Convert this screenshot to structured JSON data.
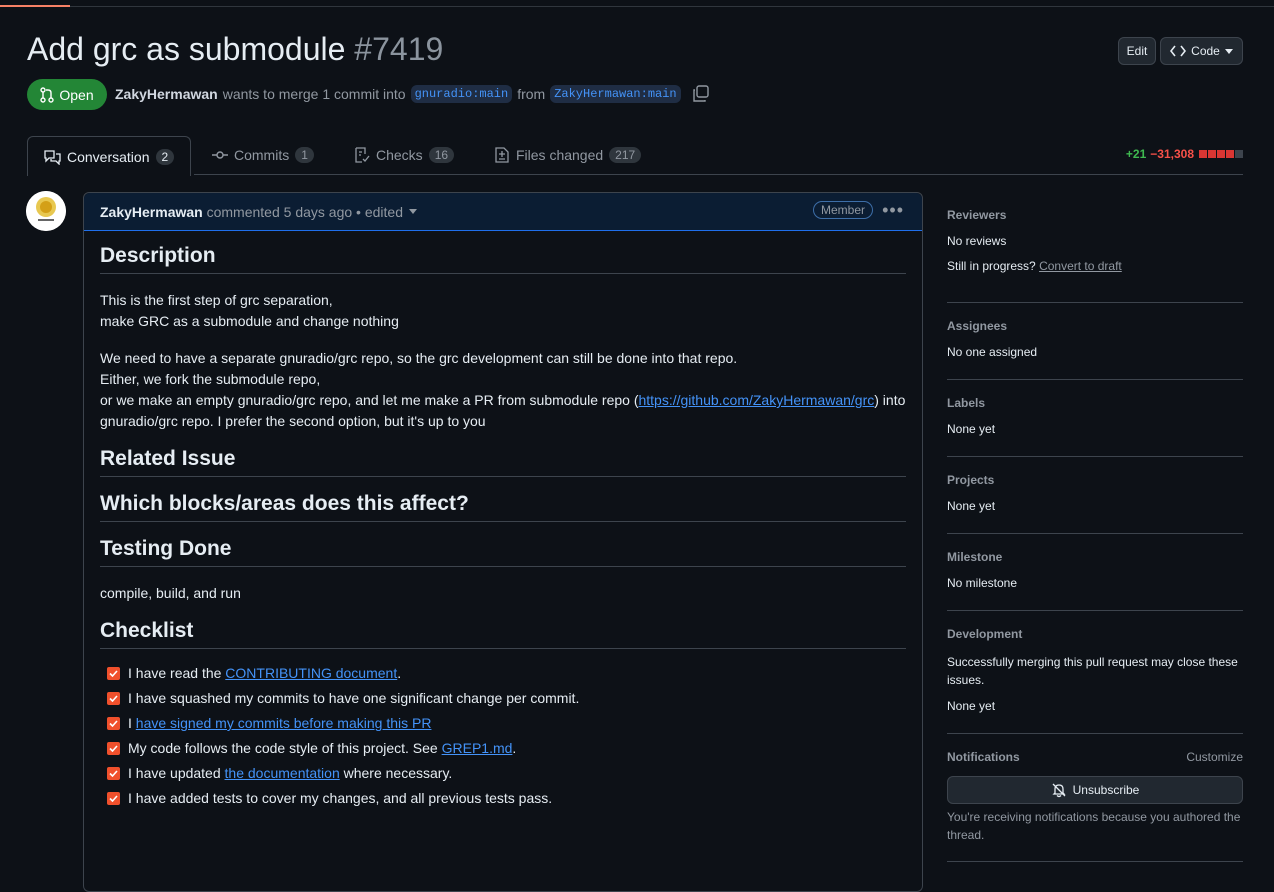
{
  "pr": {
    "title": "Add grc as submodule",
    "number": "#7419",
    "state": "Open",
    "author": "ZakyHermawan",
    "merge_text": "wants to merge 1 commit into",
    "base_branch": "gnuradio:main",
    "from_text": "from",
    "head_branch": "ZakyHermawan:main"
  },
  "header_buttons": {
    "edit": "Edit",
    "code": "Code"
  },
  "tabs": [
    {
      "label": "Conversation",
      "count": "2",
      "icon": "comment-discussion-icon"
    },
    {
      "label": "Commits",
      "count": "1",
      "icon": "git-commit-icon"
    },
    {
      "label": "Checks",
      "count": "16",
      "icon": "checklist-icon"
    },
    {
      "label": "Files changed",
      "count": "217",
      "icon": "file-diff-icon"
    }
  ],
  "diffstat": {
    "additions": "+21",
    "deletions": "−31,308"
  },
  "comment": {
    "author": "ZakyHermawan",
    "action": "commented",
    "time": "5 days ago",
    "edited": "• edited",
    "role": "Member",
    "sections": {
      "description": "Description",
      "desc_line1": "This is the first step of grc separation,",
      "desc_line2": "make GRC as a submodule and change nothing",
      "para2_line1": "We need to have a separate gnuradio/grc repo, so the grc development can still be done into that repo.",
      "para2_line2": "Either, we fork the submodule repo,",
      "para2_line3_a": "or we make an empty gnuradio/grc repo, and let me make a PR from submodule repo (",
      "para2_link": "https://github.com/ZakyHermawan/grc",
      "para2_line3_b": ") into",
      "para2_line4": "gnuradio/grc repo. I prefer the second option, but it's up to you",
      "related": "Related Issue",
      "blocks": "Which blocks/areas does this affect?",
      "testing": "Testing Done",
      "testing_text": "compile, build, and run",
      "checklist": "Checklist"
    },
    "checklist": [
      {
        "pre": "I have read the ",
        "link": "CONTRIBUTING document",
        "post": "."
      },
      {
        "pre": "I have squashed my commits to have one significant change per commit.",
        "link": "",
        "post": ""
      },
      {
        "pre": "I ",
        "link": "have signed my commits before making this PR",
        "post": ""
      },
      {
        "pre": "My code follows the code style of this project. See ",
        "link": "GREP1.md",
        "post": "."
      },
      {
        "pre": "I have updated ",
        "link": "the documentation",
        "post": " where necessary."
      },
      {
        "pre": "I have added tests to cover my changes, and all previous tests pass.",
        "link": "",
        "post": ""
      }
    ]
  },
  "sidebar": {
    "reviewers": {
      "title": "Reviewers",
      "value": "No reviews",
      "draft_q": "Still in progress?",
      "draft_link": "Convert to draft"
    },
    "assignees": {
      "title": "Assignees",
      "value": "No one assigned"
    },
    "labels": {
      "title": "Labels",
      "value": "None yet"
    },
    "projects": {
      "title": "Projects",
      "value": "None yet"
    },
    "milestone": {
      "title": "Milestone",
      "value": "No milestone"
    },
    "development": {
      "title": "Development",
      "text": "Successfully merging this pull request may close these issues.",
      "value": "None yet"
    },
    "notifications": {
      "title": "Notifications",
      "customize": "Customize",
      "button": "Unsubscribe",
      "note": "You're receiving notifications because you authored the thread."
    }
  },
  "colors": {
    "open": "#238636",
    "link": "#4493f8",
    "checkbox": "#f0502c",
    "addition": "#3fb950",
    "deletion": "#f85149"
  }
}
